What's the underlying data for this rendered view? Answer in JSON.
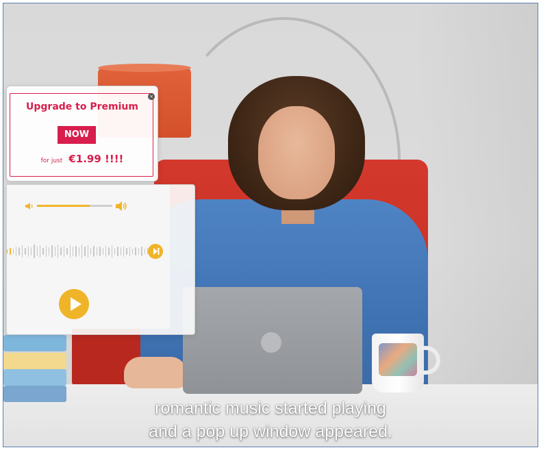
{
  "premium_popup": {
    "title": "Upgrade to Premium",
    "badge": "NOW",
    "price_prefix": "for just",
    "price": "€1.99 !!!!"
  },
  "player": {
    "volume": 0.7,
    "progress": 0.05
  },
  "subtitles": {
    "line1": "romantic music started playing",
    "line2": "and a pop up window appeared."
  },
  "colors": {
    "accent_red": "#d71e4c",
    "accent_yellow": "#f0b429",
    "shirt_blue": "#4f84c4",
    "sofa_red": "#c52d23"
  },
  "icons": {
    "close": "close-icon",
    "volume_low": "volume-low-icon",
    "volume_high": "volume-high-icon",
    "skip": "skip-forward-icon",
    "play": "play-icon"
  }
}
